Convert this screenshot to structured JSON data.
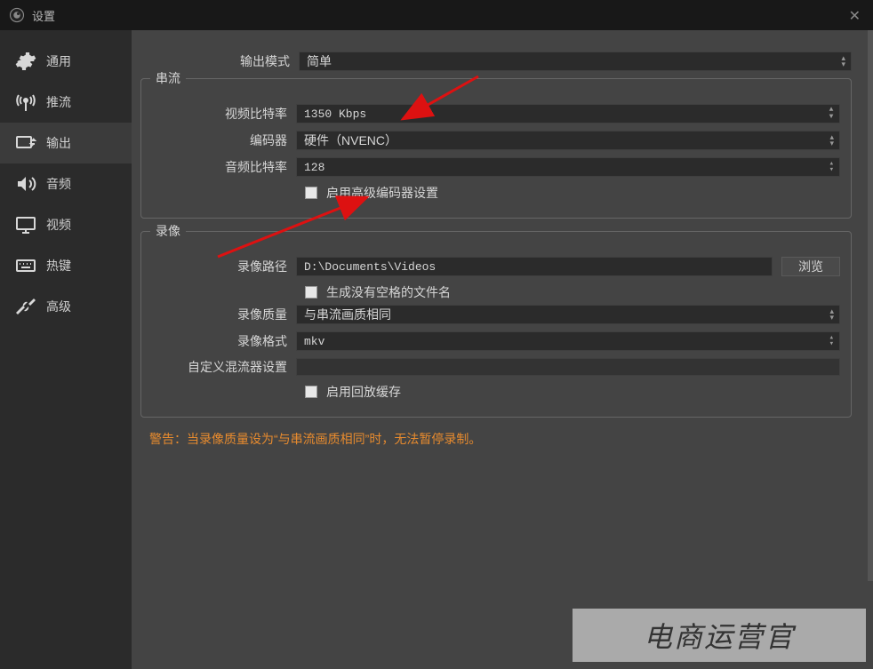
{
  "titlebar": {
    "title": "设置"
  },
  "sidebar": {
    "items": [
      {
        "label": "通用"
      },
      {
        "label": "推流"
      },
      {
        "label": "输出"
      },
      {
        "label": "音频"
      },
      {
        "label": "视频"
      },
      {
        "label": "热键"
      },
      {
        "label": "高级"
      }
    ]
  },
  "output_mode": {
    "label": "输出模式",
    "value": "简单"
  },
  "stream": {
    "legend": "串流",
    "video_bitrate": {
      "label": "视频比特率",
      "value": "1350 Kbps"
    },
    "encoder": {
      "label": "编码器",
      "value": "硬件（NVENC）"
    },
    "audio_bitrate": {
      "label": "音频比特率",
      "value": "128"
    },
    "advanced_encoder": {
      "label": "启用高级编码器设置"
    }
  },
  "recording": {
    "legend": "录像",
    "path": {
      "label": "录像路径",
      "value": "D:\\Documents\\Videos",
      "browse": "浏览"
    },
    "no_space_filename": {
      "label": "生成没有空格的文件名"
    },
    "quality": {
      "label": "录像质量",
      "value": "与串流画质相同"
    },
    "format": {
      "label": "录像格式",
      "value": "mkv"
    },
    "muxer": {
      "label": "自定义混流器设置",
      "value": ""
    },
    "replay_buffer": {
      "label": "启用回放缓存"
    }
  },
  "warning": "警告：当录像质量设为“与串流画质相同”时，无法暂停录制。",
  "watermark": "电商运营官"
}
